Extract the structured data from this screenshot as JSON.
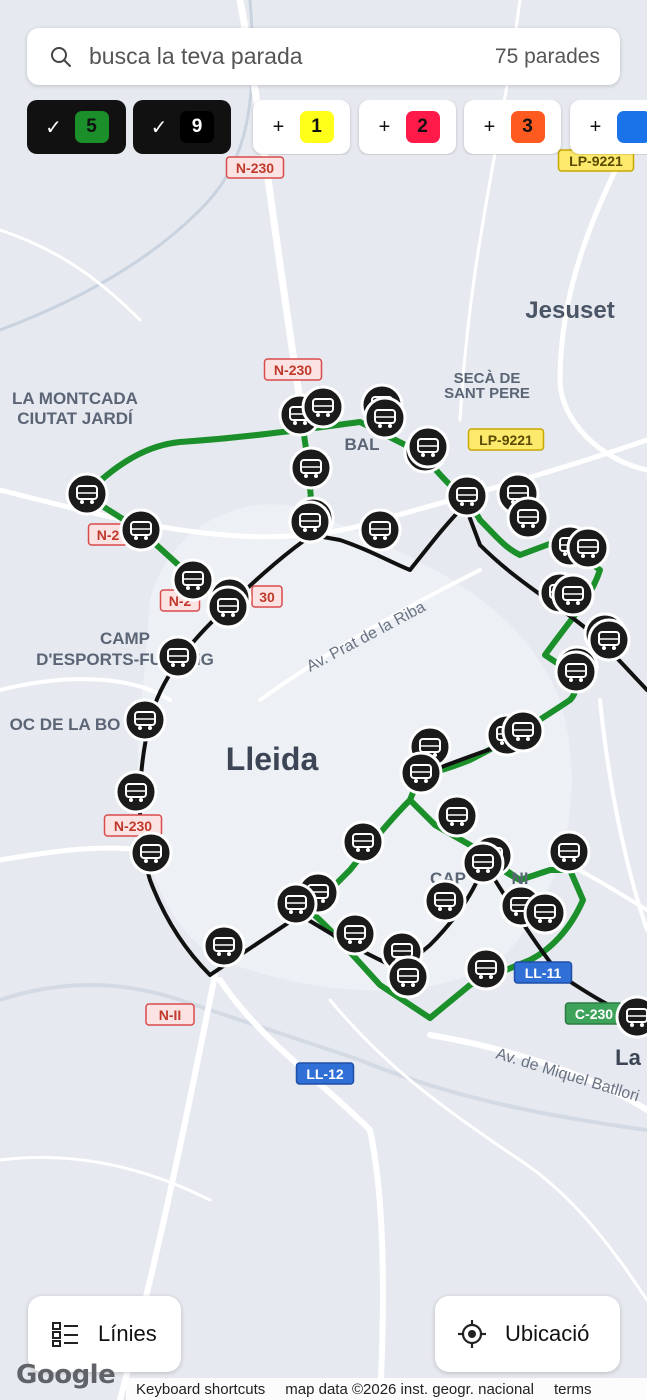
{
  "search": {
    "placeholder": "busca la teva parada",
    "count": "75 parades"
  },
  "line_chips": [
    {
      "number": "5",
      "state": "selected",
      "mark": "✓",
      "badge_color": "#1a8f2a",
      "text_color": "#111111"
    },
    {
      "number": "9",
      "state": "selected",
      "mark": "✓",
      "badge_color": "#000000",
      "text_color": "#ffffff"
    },
    {
      "number": "1",
      "state": "add",
      "mark": "+",
      "badge_color": "#ffff1a",
      "text_color": "#111111"
    },
    {
      "number": "2",
      "state": "add",
      "mark": "+",
      "badge_color": "#ff1a4a",
      "text_color": "#111111"
    },
    {
      "number": "3",
      "state": "add",
      "mark": "+",
      "badge_color": "#ff5a1f",
      "text_color": "#111111"
    },
    {
      "number": "",
      "state": "add",
      "mark": "+",
      "badge_color": "#1a73e8",
      "text_color": "#ffffff"
    }
  ],
  "map_labels": {
    "jesuset": "Jesuset",
    "seca1": "SECÀ DE",
    "seca2": "SANT PERE",
    "montcada1": "LA MONTCADA",
    "montcada2": "CIUTAT JARDÍ",
    "camp1": "CAMP",
    "camp2": "D'ESPORTS-FUSTING",
    "boc": "OC DE LA BO",
    "lleida": "Lleida",
    "prat": "Av. Prat de la Riba",
    "miquel": "Av. de Miquel Batllori",
    "la": "La",
    "bal": "BAL",
    "cap": "CAP",
    "ni": "NI"
  },
  "road_shields": [
    {
      "label": "N-230",
      "kind": "red"
    },
    {
      "label": "N-230",
      "kind": "red"
    },
    {
      "label": "N-2",
      "kind": "red"
    },
    {
      "label": "N-2",
      "kind": "red"
    },
    {
      "label": "30",
      "kind": "red"
    },
    {
      "label": "N-230",
      "kind": "red"
    },
    {
      "label": "N-II",
      "kind": "red"
    },
    {
      "label": "LP-9221",
      "kind": "yellow"
    },
    {
      "label": "LP-9221",
      "kind": "yellow"
    },
    {
      "label": "LL-12",
      "kind": "blue"
    },
    {
      "label": "LL-11",
      "kind": "blue"
    },
    {
      "label": "C-230",
      "kind": "green"
    }
  ],
  "route_colors": {
    "line5": "#1a8f2a",
    "line9": "#111111"
  },
  "stop_icon": "bus-icon",
  "buttons": {
    "lines": "Línies",
    "location": "Ubicació"
  },
  "icons": {
    "lines": "list-icon",
    "location": "crosshair-icon",
    "search": "search-icon"
  },
  "attribution": {
    "logo": "Google",
    "shortcuts": "Keyboard shortcuts",
    "map_data": "map data ©2026 inst. geogr. nacional",
    "terms": "terms"
  }
}
